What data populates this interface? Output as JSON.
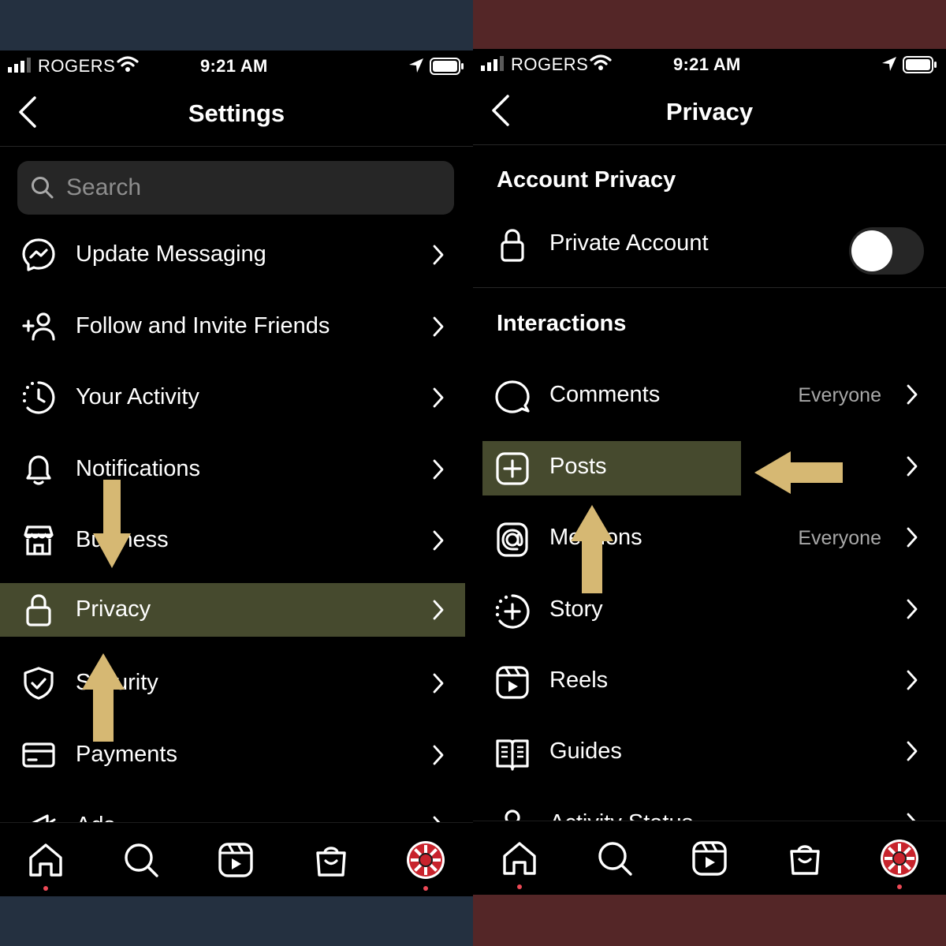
{
  "colors": {
    "left_frame": "#243040",
    "right_frame": "#542627",
    "highlight": "#464a2e",
    "arrow": "#d6b873",
    "notification_dot": "#ed4956"
  },
  "left": {
    "status": {
      "carrier": "ROGERS",
      "time": "9:21 AM"
    },
    "header": {
      "title": "Settings"
    },
    "search": {
      "placeholder": "Search"
    },
    "items": [
      {
        "label": "Update Messaging",
        "icon": "messenger-icon"
      },
      {
        "label": "Follow and Invite Friends",
        "icon": "add-person-icon"
      },
      {
        "label": "Your Activity",
        "icon": "activity-clock-icon"
      },
      {
        "label": "Notifications",
        "icon": "bell-icon"
      },
      {
        "label": "Business",
        "icon": "shop-icon"
      },
      {
        "label": "Privacy",
        "icon": "lock-icon",
        "highlighted": true
      },
      {
        "label": "Security",
        "icon": "shield-check-icon"
      },
      {
        "label": "Payments",
        "icon": "credit-card-icon"
      },
      {
        "label": "Ads",
        "icon": "megaphone-icon"
      }
    ]
  },
  "right": {
    "status": {
      "carrier": "ROGERS",
      "time": "9:21 AM"
    },
    "header": {
      "title": "Privacy"
    },
    "account_privacy": {
      "heading": "Account Privacy",
      "private_account": {
        "label": "Private Account",
        "enabled": false
      }
    },
    "interactions": {
      "heading": "Interactions",
      "items": [
        {
          "label": "Comments",
          "value": "Everyone",
          "icon": "comment-icon"
        },
        {
          "label": "Posts",
          "value": "",
          "icon": "plus-square-icon",
          "highlighted": true
        },
        {
          "label": "Mentions",
          "value": "Everyone",
          "icon": "at-sign-icon"
        },
        {
          "label": "Story",
          "value": "",
          "icon": "story-plus-icon"
        },
        {
          "label": "Reels",
          "value": "",
          "icon": "reels-icon"
        },
        {
          "label": "Guides",
          "value": "",
          "icon": "guides-icon"
        },
        {
          "label": "Activity Status",
          "value": "",
          "icon": "activity-status-icon"
        }
      ]
    }
  },
  "tabbar": [
    "home-icon",
    "search-icon",
    "reels-icon",
    "shop-icon",
    "profile-avatar"
  ]
}
